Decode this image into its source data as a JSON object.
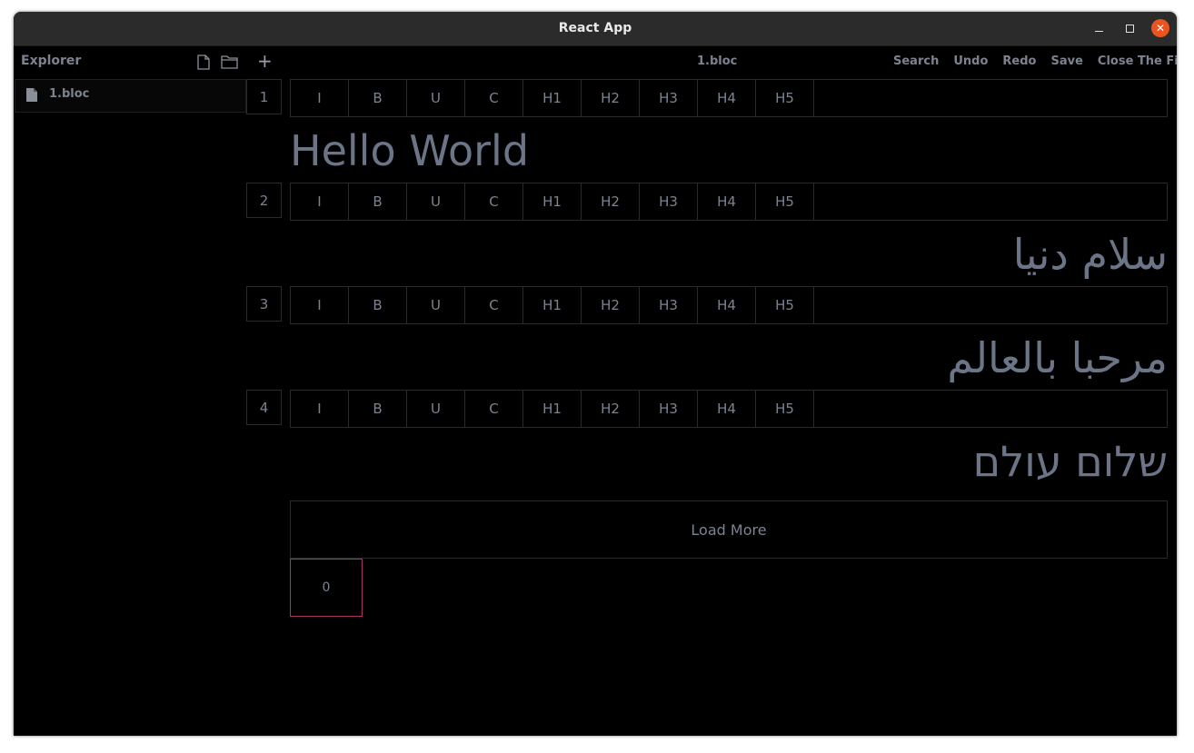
{
  "window": {
    "title": "React App"
  },
  "sidebar": {
    "heading": "Explorer",
    "icons": [
      "new-file-icon",
      "new-folder-icon"
    ],
    "files": [
      {
        "name": "1.bloc"
      }
    ]
  },
  "editor": {
    "add_symbol": "+",
    "file_title": "1.bloc",
    "actions": [
      "Search",
      "Undo",
      "Redo",
      "Save",
      "Close The File"
    ],
    "format_buttons": [
      "I",
      "B",
      "U",
      "C",
      "H1",
      "H2",
      "H3",
      "H4",
      "H5"
    ],
    "blocks": [
      {
        "line": "1",
        "text": "Hello World",
        "dir": "ltr"
      },
      {
        "line": "2",
        "text": "سلام دنیا",
        "dir": "rtl"
      },
      {
        "line": "3",
        "text": "مرحبا بالعالم",
        "dir": "rtl"
      },
      {
        "line": "4",
        "text": "שלום עולם",
        "dir": "rtl"
      }
    ],
    "load_more": "Load More",
    "counter": "0"
  },
  "colors": {
    "accent_border": "#a8336b",
    "close_button": "#e95420",
    "text_muted": "#7b8390"
  }
}
